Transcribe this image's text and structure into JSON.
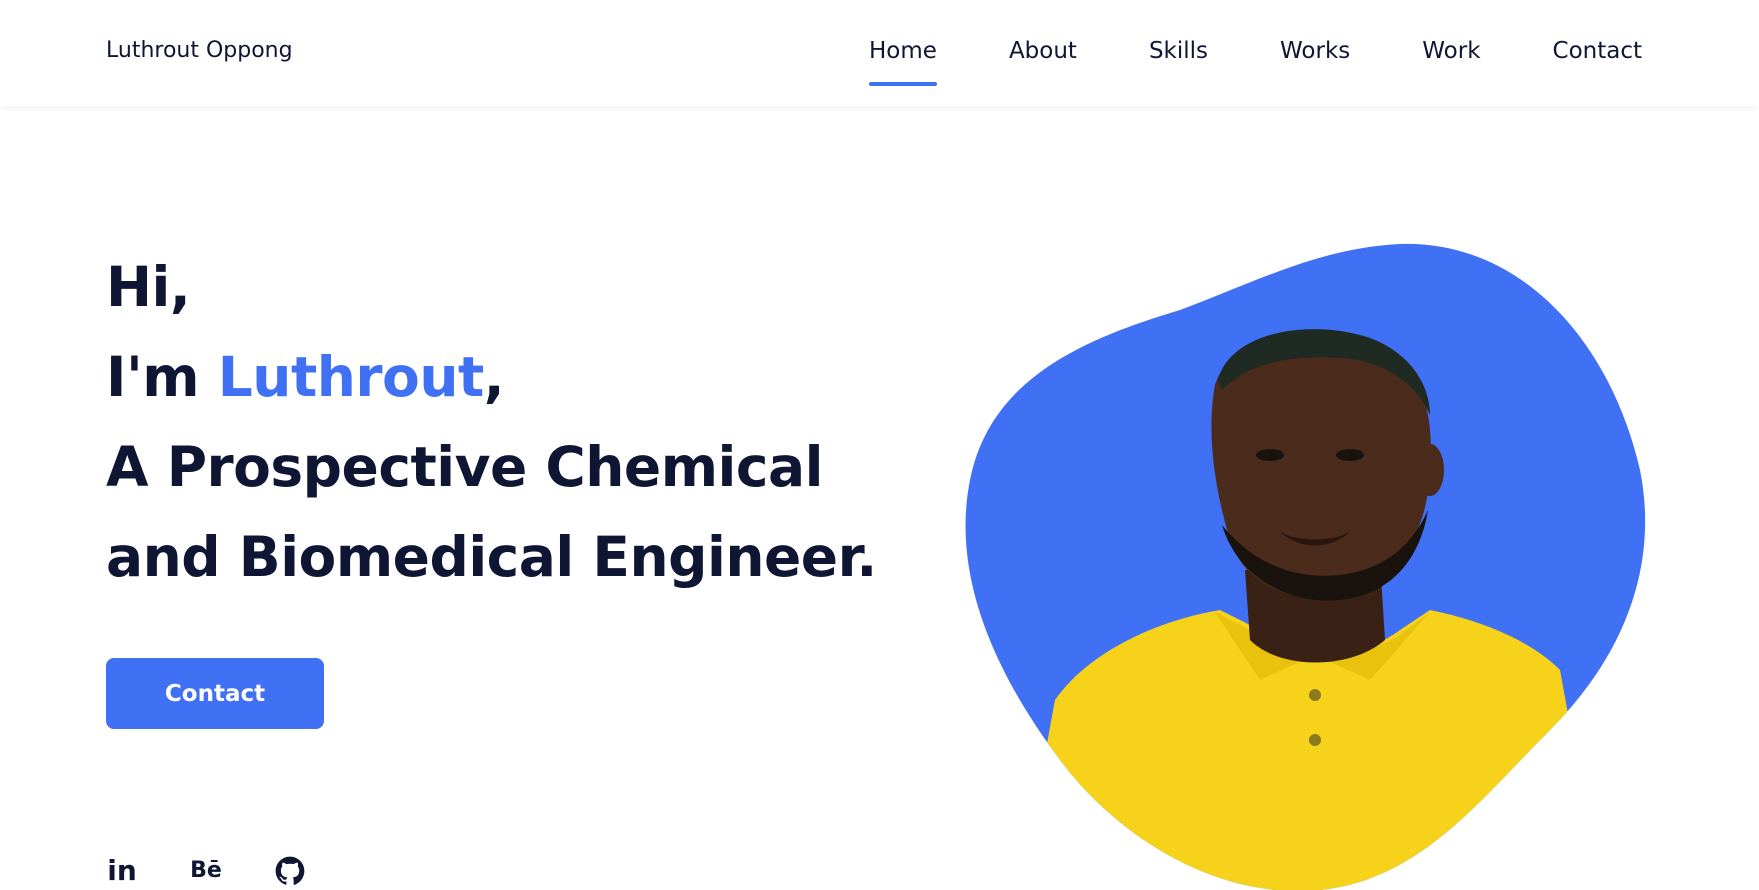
{
  "header": {
    "brand": "Luthrout Oppong",
    "nav": [
      {
        "label": "Home",
        "active": true
      },
      {
        "label": "About",
        "active": false
      },
      {
        "label": "Skills",
        "active": false
      },
      {
        "label": "Works",
        "active": false
      },
      {
        "label": "Work",
        "active": false
      },
      {
        "label": "Contact",
        "active": false
      }
    ]
  },
  "hero": {
    "line1": "Hi,",
    "line2_prefix": "I'm ",
    "line2_name": "Luthrout",
    "line2_suffix": ",",
    "line3": "A Prospective Chemical",
    "line4": "and Biomedical Engineer.",
    "button_label": "Contact"
  },
  "socials": [
    {
      "icon": "linkedin-icon",
      "glyph": "in"
    },
    {
      "icon": "behance-icon",
      "glyph": "Bē"
    },
    {
      "icon": "github-icon",
      "glyph": ""
    }
  ],
  "colors": {
    "accent": "#4070f4",
    "text": "#0f1633",
    "shirt": "#f7d21a"
  }
}
